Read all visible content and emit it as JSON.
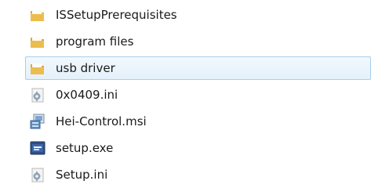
{
  "file_list": {
    "items": [
      {
        "name": "ISSetupPrerequisites",
        "type": "folder",
        "icon": "folder-icon",
        "selected": false
      },
      {
        "name": "program files",
        "type": "folder",
        "icon": "folder-icon",
        "selected": false
      },
      {
        "name": "usb driver",
        "type": "folder",
        "icon": "folder-icon",
        "selected": true
      },
      {
        "name": "0x0409.ini",
        "type": "ini",
        "icon": "settings-file-icon",
        "selected": false
      },
      {
        "name": "Hei-Control.msi",
        "type": "msi",
        "icon": "installer-package-icon",
        "selected": false
      },
      {
        "name": "setup.exe",
        "type": "exe",
        "icon": "setup-exe-icon",
        "selected": false
      },
      {
        "name": "Setup.ini",
        "type": "ini",
        "icon": "settings-file-icon",
        "selected": false
      }
    ],
    "colors": {
      "selection_background": "#e4f1fb",
      "selection_border": "#a8cfe9",
      "folder": "#e8b94c"
    }
  }
}
